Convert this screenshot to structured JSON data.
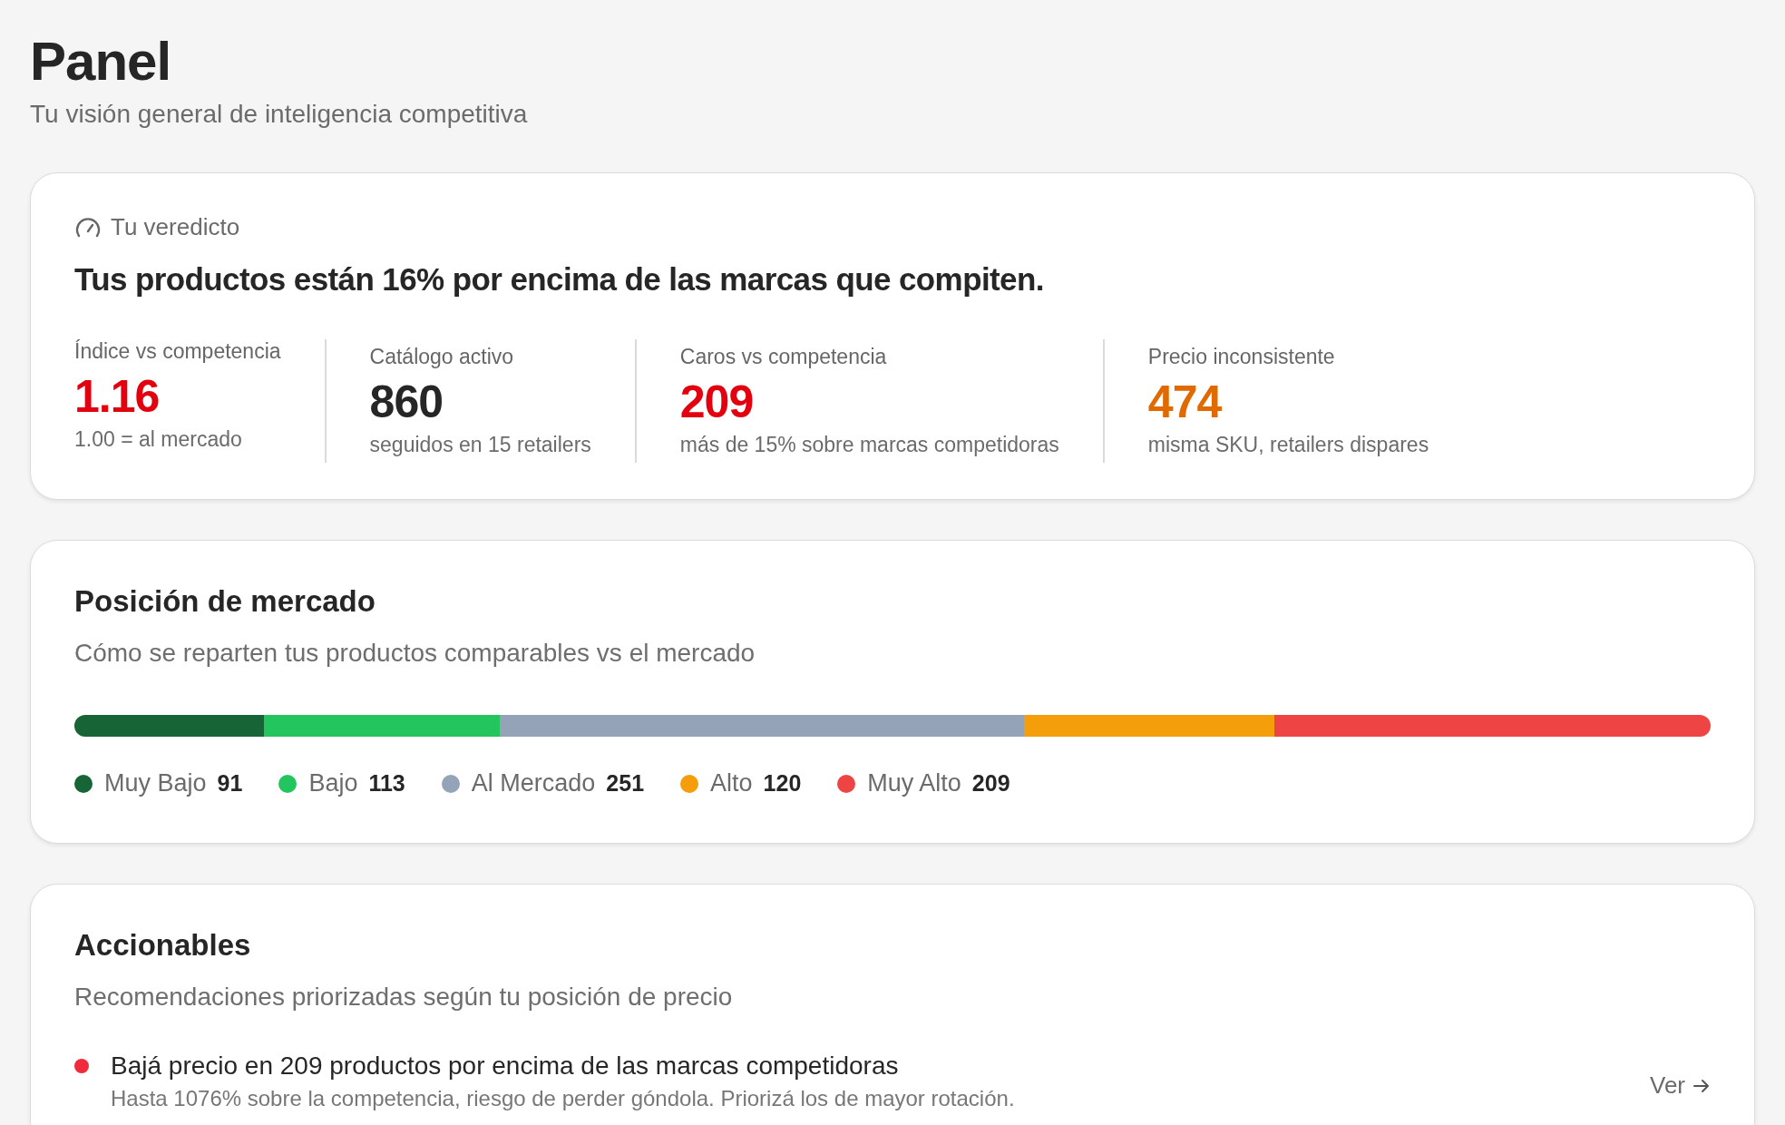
{
  "header": {
    "title": "Panel",
    "subtitle": "Tu visión general de inteligencia competitiva"
  },
  "verdict": {
    "label": "Tu veredicto",
    "headline": "Tus productos están 16% por encima de las marcas que compiten.",
    "stats": [
      {
        "label": "Índice vs competencia",
        "value": "1.16",
        "note": "1.00 = al mercado",
        "color": "#e3000f"
      },
      {
        "label": "Catálogo activo",
        "value": "860",
        "note": "seguidos en 15 retailers",
        "color": "#262626"
      },
      {
        "label": "Caros vs competencia",
        "value": "209",
        "note": "más de 15% sobre marcas competidoras",
        "color": "#e3000f"
      },
      {
        "label": "Precio inconsistente",
        "value": "474",
        "note": "misma SKU, retailers dispares",
        "color": "#e06a00"
      }
    ]
  },
  "market": {
    "title": "Posición de mercado",
    "subtitle": "Cómo se reparten tus productos comparables vs el mercado",
    "segments": [
      {
        "name": "Muy Bajo",
        "count": "91",
        "color": "#176536"
      },
      {
        "name": "Bajo",
        "count": "113",
        "color": "#22c55e"
      },
      {
        "name": "Al Mercado",
        "count": "251",
        "color": "#94a3b8"
      },
      {
        "name": "Alto",
        "count": "120",
        "color": "#f59e0b"
      },
      {
        "name": "Muy Alto",
        "count": "209",
        "color": "#ef4444"
      }
    ]
  },
  "actions": {
    "title": "Accionables",
    "subtitle": "Recomendaciones priorizadas según tu posición de precio",
    "items": [
      {
        "title": "Bajá precio en 209 productos por encima de las marcas competidoras",
        "detail": "Hasta 1076% sobre la competencia, riesgo de perder góndola. Priorizá los de mayor rotación.",
        "link": "Ver",
        "color": "#ef2b3c"
      }
    ]
  }
}
